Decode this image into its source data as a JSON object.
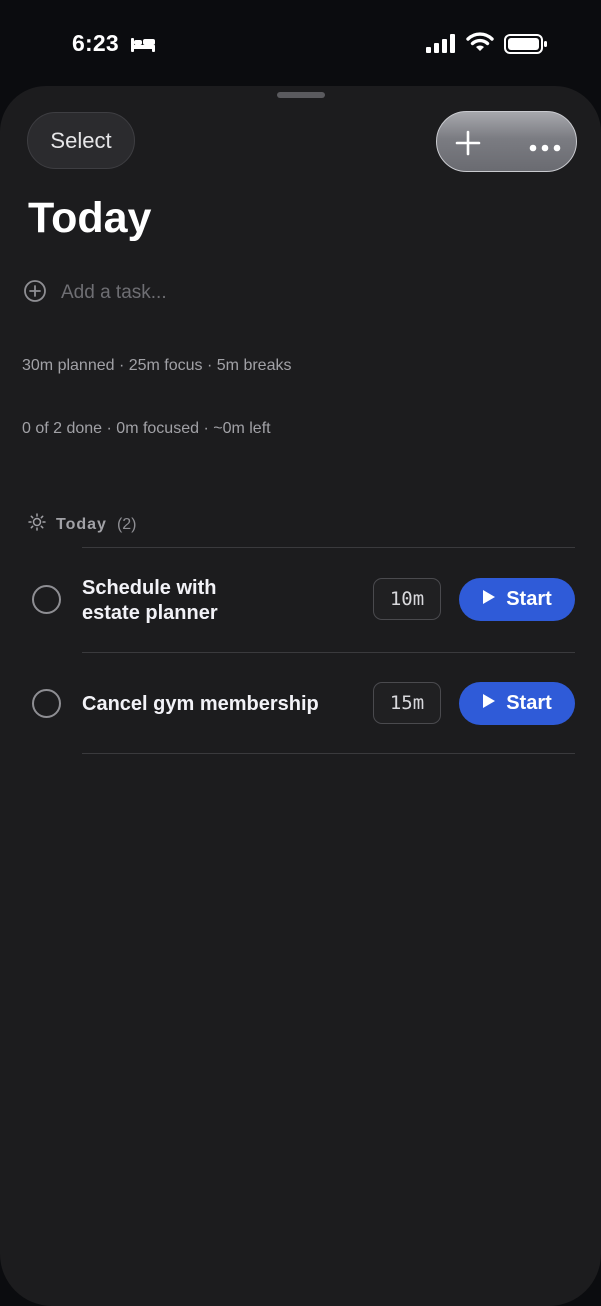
{
  "status_bar": {
    "time": "6:23"
  },
  "header": {
    "select_label": "Select",
    "title": "Today"
  },
  "add_task": {
    "placeholder": "Add a task..."
  },
  "stats": {
    "planned_line": "30m planned · 25m focus · 5m breaks",
    "progress_line": "0 of 2 done · 0m focused · ~0m left"
  },
  "section": {
    "label": "Today",
    "count": "(2)"
  },
  "tasks": [
    {
      "title": "Schedule with\nestate planner",
      "duration": "10m",
      "start_label": "Start"
    },
    {
      "title": "Cancel gym membership",
      "duration": "15m",
      "start_label": "Start"
    }
  ],
  "colors": {
    "accent": "#2f5bd8",
    "sheet": "#1c1c1e",
    "background": "#0b0c0f"
  },
  "icons": [
    "bed-icon",
    "signal-icon",
    "wifi-icon",
    "battery-icon",
    "plus-icon",
    "more-icon",
    "add-circle-icon",
    "sun-icon",
    "play-icon"
  ]
}
